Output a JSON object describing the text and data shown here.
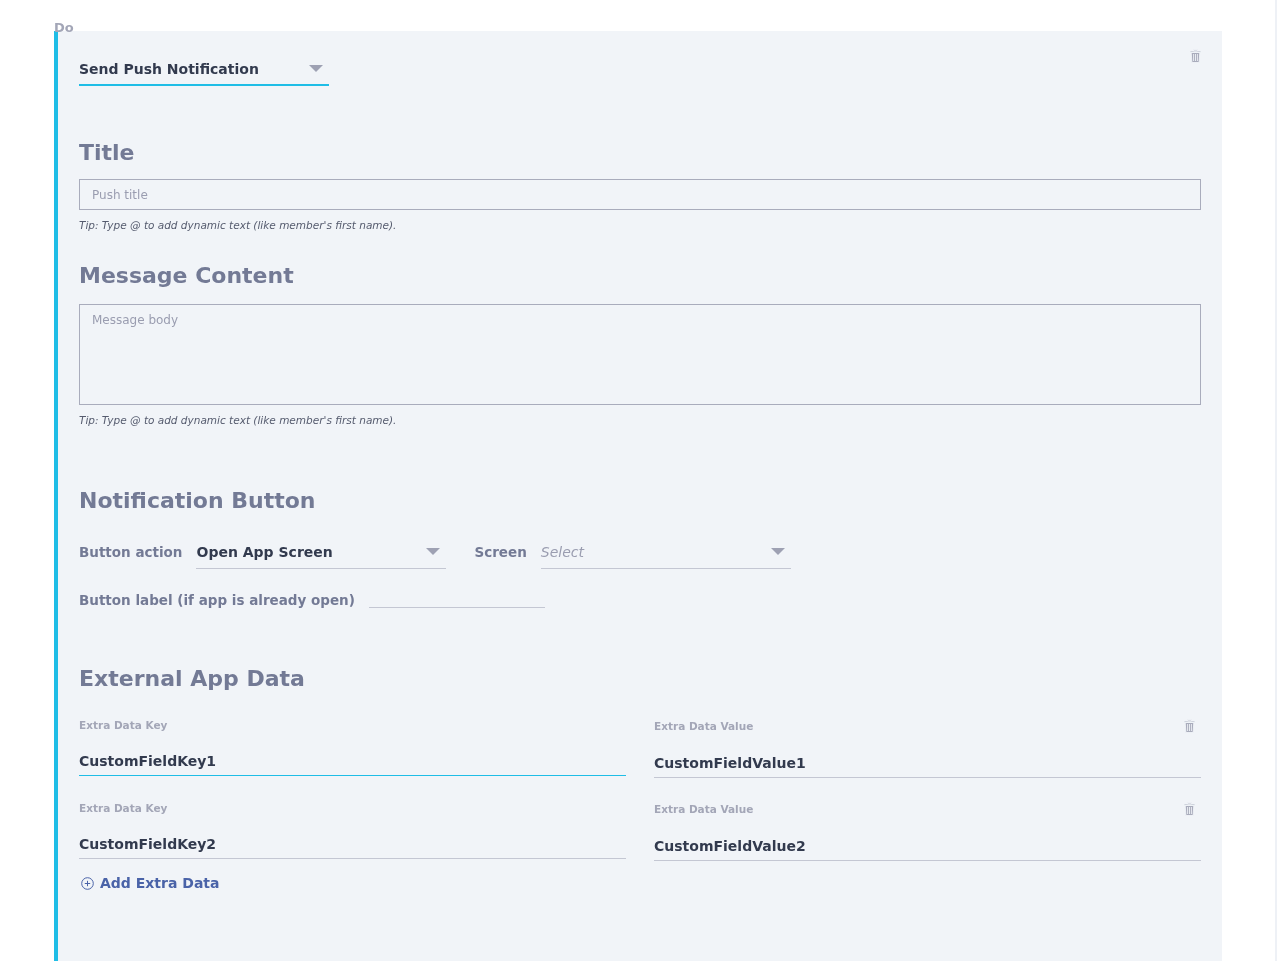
{
  "section_label": "Do",
  "action": {
    "value": "Send Push Notification",
    "focused": true
  },
  "title_section": {
    "heading": "Title",
    "placeholder": "Push title",
    "tip": "Tip: Type @ to add dynamic text (like member's first name)."
  },
  "message_section": {
    "heading": "Message Content",
    "placeholder": "Message body",
    "tip": "Tip: Type @ to add dynamic text (like member's first name)."
  },
  "notification_button": {
    "heading": "Notification Button",
    "action_label": "Button action",
    "action_value": "Open App Screen",
    "screen_label": "Screen",
    "screen_placeholder": "Select",
    "button_label_label": "Button label (if app is already open)"
  },
  "external_app_data": {
    "heading": "External App Data",
    "rows": [
      {
        "key_label": "Extra Data Key",
        "key": "CustomFieldKey1",
        "key_focused": true,
        "value_label": "Extra Data Value",
        "value": "CustomFieldValue1"
      },
      {
        "key_label": "Extra Data Key",
        "key": "CustomFieldKey2",
        "key_focused": false,
        "value_label": "Extra Data Value",
        "value": "CustomFieldValue2"
      }
    ],
    "add_label": "Add Extra Data"
  }
}
